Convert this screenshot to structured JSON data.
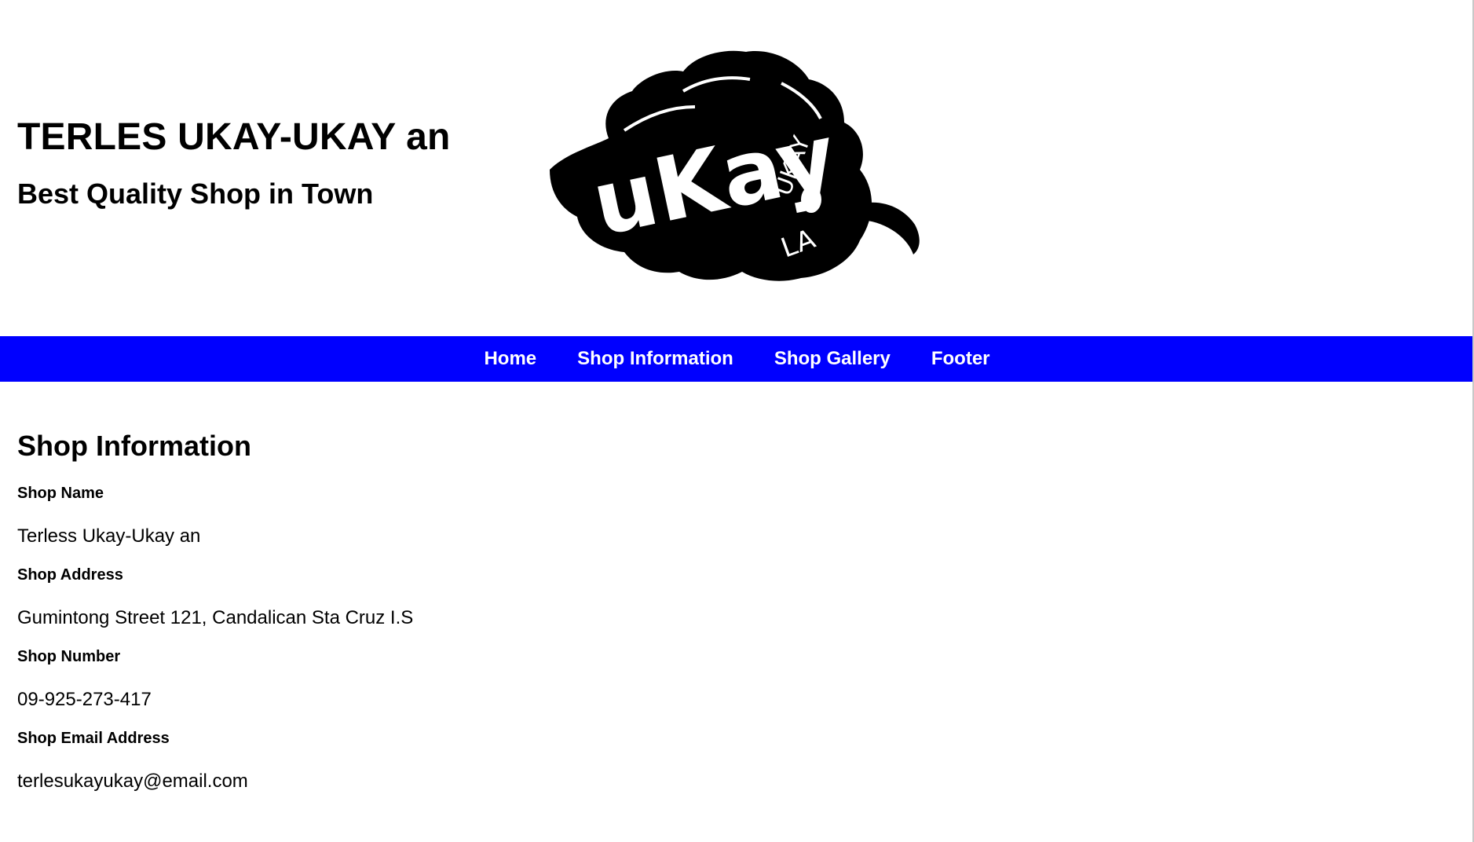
{
  "header": {
    "title": "TERLES UKAY-UKAY an",
    "subtitle": "Best Quality Shop in Town",
    "logo": {
      "text_main": "uKay",
      "text_side": "UKAY",
      "text_bottom": "LA",
      "icon": "leaf-logo-icon"
    }
  },
  "nav": {
    "items": [
      {
        "label": "Home"
      },
      {
        "label": "Shop Information"
      },
      {
        "label": "Shop Gallery"
      },
      {
        "label": "Footer"
      }
    ],
    "background_color": "#0000ff",
    "text_color": "#ffffff"
  },
  "main": {
    "heading": "Shop Information",
    "fields": [
      {
        "label": "Shop Name",
        "value": "Terless Ukay-Ukay an"
      },
      {
        "label": "Shop Address",
        "value": "Gumintong Street 121, Candalican Sta Cruz I.S"
      },
      {
        "label": "Shop Number",
        "value": "09-925-273-417"
      },
      {
        "label": "Shop Email Address",
        "value": "terlesukayukay@email.com"
      }
    ]
  }
}
